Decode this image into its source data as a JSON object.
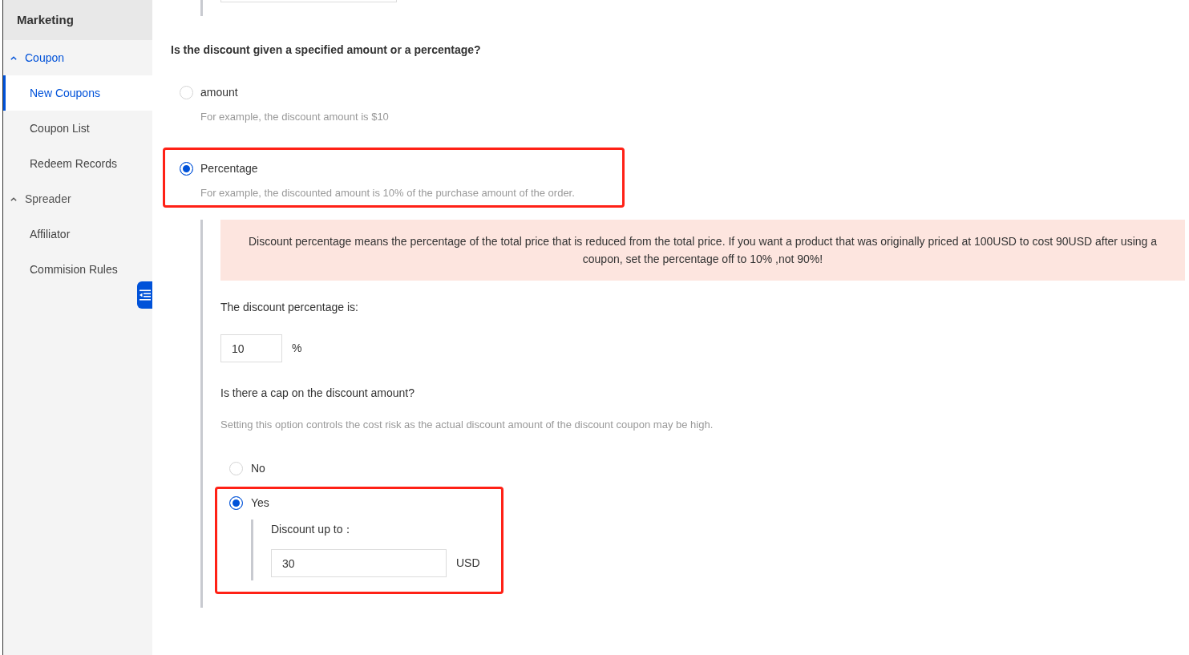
{
  "sidebar": {
    "title": "Marketing",
    "groups": [
      {
        "label": "Coupon",
        "expanded": true,
        "children": [
          {
            "label": "New Coupons",
            "selected": true
          },
          {
            "label": "Coupon List",
            "selected": false
          },
          {
            "label": "Redeem Records",
            "selected": false
          }
        ]
      },
      {
        "label": "Spreader",
        "expanded": true,
        "children": [
          {
            "label": "Affiliator",
            "selected": false
          },
          {
            "label": "Commision Rules",
            "selected": false
          }
        ]
      }
    ]
  },
  "discount_type": {
    "question": "Is the discount given a specified amount or a percentage?",
    "options": [
      {
        "label": "amount",
        "hint": "For example, the discount amount is $10",
        "selected": false,
        "highlighted": false
      },
      {
        "label": "Percentage",
        "hint": "For example, the discounted amount is 10% of the purchase amount of the order.",
        "selected": true,
        "highlighted": true
      }
    ]
  },
  "percentage_settings": {
    "notice": "Discount percentage means the percentage of the total price that is reduced from the total price. If you want a product that was originally priced at 100USD to cost 90USD after using a coupon, set the percentage off to 10% ,not 90%!",
    "percentage_label": "The discount percentage is:",
    "percentage_value": "10",
    "percentage_unit": "%",
    "cap_question": "Is there a cap on the discount amount?",
    "cap_hint": "Setting this option controls the cost risk as the actual discount amount of the discount coupon may be high.",
    "cap_options": [
      {
        "label": "No",
        "selected": false,
        "highlighted": false
      },
      {
        "label": "Yes",
        "selected": true,
        "highlighted": true,
        "limit_label": "Discount up to：",
        "limit_value": "30",
        "limit_unit": "USD"
      }
    ]
  }
}
